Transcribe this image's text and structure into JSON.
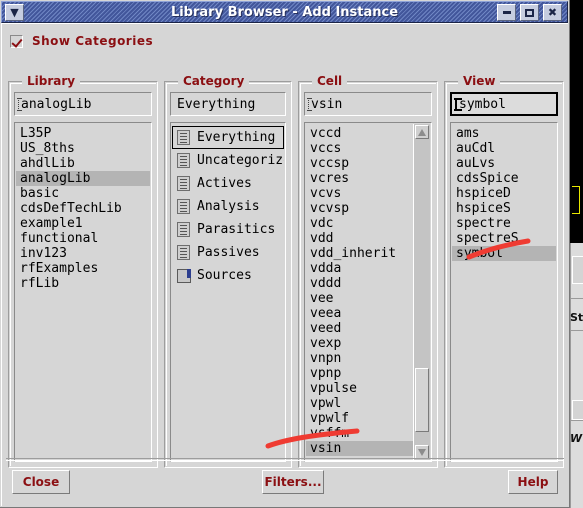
{
  "window": {
    "title": "Library Browser - Add Instance",
    "menu_icon": "chevron-down-icon",
    "minimize_label": "",
    "maximize_label": "",
    "close_label": "✖"
  },
  "show_categories": {
    "label": "Show Categories",
    "checked": true
  },
  "panels": {
    "library": {
      "title": "Library",
      "field_value": "analogLib",
      "selected": "analogLib",
      "items": [
        "L35P",
        "US_8ths",
        "ahdlLib",
        "analogLib",
        "basic",
        "cdsDefTechLib",
        "example1",
        "functional",
        "inv123",
        "rfExamples",
        "rfLib"
      ]
    },
    "category": {
      "title": "Category",
      "field_value": "Everything",
      "selected": "Everything",
      "items": [
        {
          "label": "Everything",
          "icon": "document-icon"
        },
        {
          "label": "Uncategorized",
          "icon": "document-icon"
        },
        {
          "label": "Actives",
          "icon": "document-icon"
        },
        {
          "label": "Analysis",
          "icon": "document-icon"
        },
        {
          "label": "Parasitics",
          "icon": "document-icon"
        },
        {
          "label": "Passives",
          "icon": "document-icon"
        },
        {
          "label": "Sources",
          "icon": "folder-icon"
        }
      ]
    },
    "cell": {
      "title": "Cell",
      "field_value": "vsin",
      "selected": "vsin",
      "items": [
        "vccd",
        "vccs",
        "vccsp",
        "vcres",
        "vcvs",
        "vcvsp",
        "vdc",
        "vdd",
        "vdd_inherit",
        "vdda",
        "vddd",
        "vee",
        "veea",
        "veed",
        "vexp",
        "vnpn",
        "vpnp",
        "vpulse",
        "vpwl",
        "vpwlf",
        "vsffm",
        "vsin"
      ],
      "scrollbar": {
        "up_icon": "triangle-up-icon",
        "down_icon": "triangle-down-icon"
      }
    },
    "view": {
      "title": "View",
      "field_value": "symbol",
      "field_focused": true,
      "selected": "symbol",
      "items": [
        "ams",
        "auCdl",
        "auLvs",
        "cdsSpice",
        "hspiceD",
        "hspiceS",
        "spectre",
        "spectreS",
        "symbol"
      ]
    }
  },
  "buttons": {
    "close": "Close",
    "filters": "Filters...",
    "help": "Help"
  },
  "background_window": {
    "label_st": "St",
    "label_wi": "W"
  },
  "colors": {
    "accent_red": "#8b0f12",
    "titlebar_blue": "#42569b",
    "face": "#d6d6d6",
    "selection": "#b4b4b4",
    "annotation_red": "#ef3b32"
  }
}
